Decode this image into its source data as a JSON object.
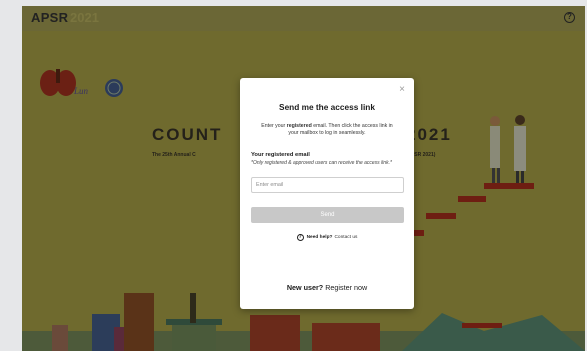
{
  "colors": {
    "background_dim": "#6f6a2e",
    "step_red": "#6e1e12",
    "modal_bg": "#ffffff",
    "send_disabled": "#c8c8c8"
  },
  "header": {
    "logo_text": "APSR",
    "logo_year": "2021",
    "help_icon": "question-circle-icon"
  },
  "background": {
    "headline_left": "COUNT",
    "headline_right": "2021",
    "subline_left": "The 25th Annual C",
    "subline_right": "logy (APSR 2021)"
  },
  "modal": {
    "title": "Send me the access link",
    "intro_pre": "Enter your ",
    "intro_bold": "registered",
    "intro_post": " email. Then click the access link in your mailbox to log in seamlessly.",
    "email_label": "Your registered email",
    "email_note": "*Only registered & approved users can receive the access link.*",
    "email_placeholder": "Enter email",
    "email_value": "",
    "send_label": "Send",
    "close_label": "×",
    "help_icon": "question-circle-icon",
    "need_help": "Need help?",
    "contact_us": "Contact us",
    "new_user": "New user?",
    "register_now": "Register now"
  }
}
